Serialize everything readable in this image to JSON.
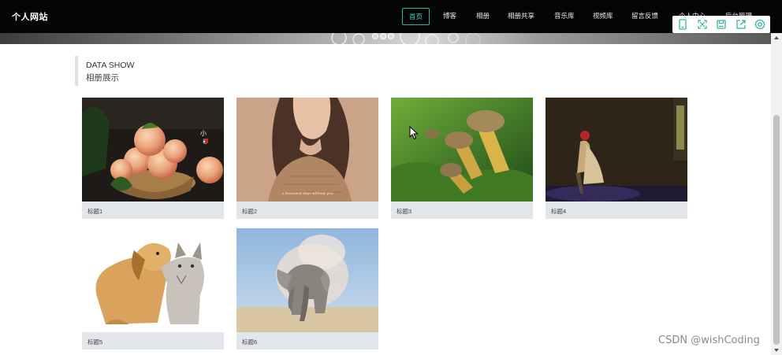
{
  "brand": "个人网站",
  "nav": [
    {
      "label": "首页",
      "active": true
    },
    {
      "label": "博客"
    },
    {
      "label": "相册"
    },
    {
      "label": "相册共享"
    },
    {
      "label": "音乐库"
    },
    {
      "label": "视频库"
    },
    {
      "label": "留言反馈"
    },
    {
      "label": "个人中心"
    },
    {
      "label": "后台管理"
    }
  ],
  "toolbar_icons": [
    "tablet-icon",
    "fullscreen-icon",
    "save-icon",
    "share-icon",
    "settings-icon"
  ],
  "accent_color": "#2fb4a4",
  "section": {
    "title_en": "DATA SHOW",
    "title_cn": "相册展示"
  },
  "albums": [
    {
      "caption": "标题1",
      "scene": "peaches"
    },
    {
      "caption": "标题2",
      "scene": "woman-sweater",
      "overlay_text": "a thousand days without you"
    },
    {
      "caption": "标题3",
      "scene": "mushrooms"
    },
    {
      "caption": "标题4",
      "scene": "seated-figure"
    },
    {
      "caption": "标题5",
      "scene": "puppy-kitten"
    },
    {
      "caption": "标题6",
      "scene": "elephant-dust"
    }
  ],
  "watermark": "CSDN @wishCoding"
}
